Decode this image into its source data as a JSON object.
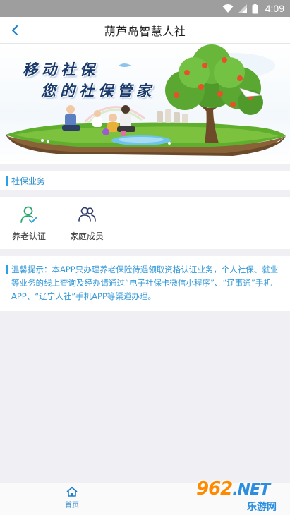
{
  "status_bar": {
    "time": "4:09"
  },
  "header": {
    "title": "葫芦岛智慧人社"
  },
  "banner": {
    "line1": "移动社保",
    "line2": "您的社保管家"
  },
  "section": {
    "title": "社保业务"
  },
  "services": [
    {
      "label": "养老认证",
      "icon": "user-check-icon"
    },
    {
      "label": "家庭成员",
      "icon": "family-icon"
    }
  ],
  "tip": {
    "text": "温馨提示：本APP只办理养老保险待遇领取资格认证业务，个人社保、就业等业务的线上查询及经办请通过“电子社保卡微信小程序”、“辽事通”手机APP、“辽宁人社”手机APP等渠道办理。"
  },
  "bottom_nav": {
    "home_label": "首页"
  },
  "watermark": {
    "brand": "962",
    "domain": ".NET",
    "site": "乐游网"
  },
  "colors": {
    "accent": "#2aa0e6",
    "tip_text": "#3398d8",
    "status_bar": "#9e9e9e"
  }
}
